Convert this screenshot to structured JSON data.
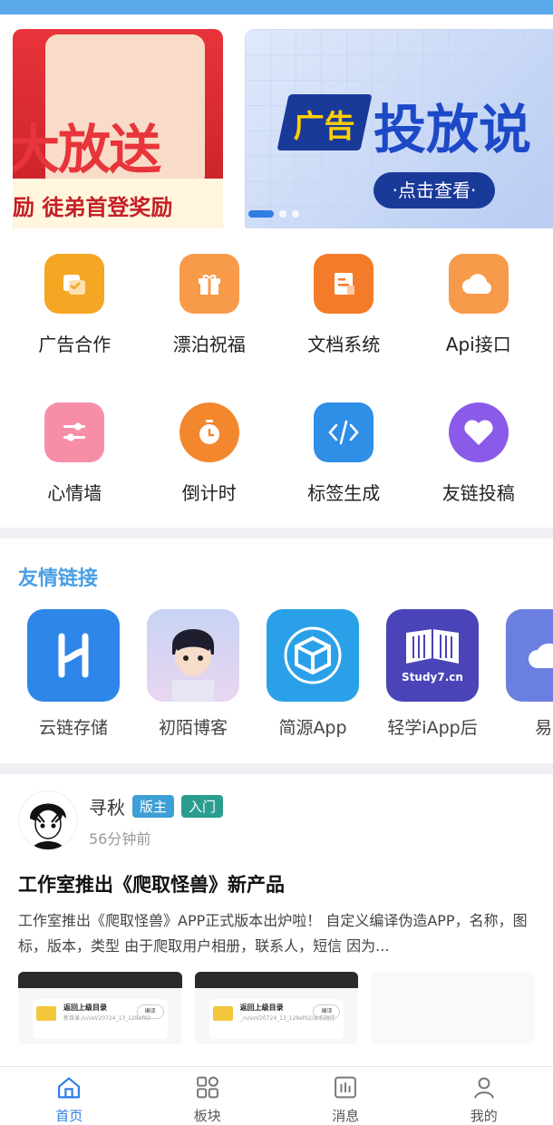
{
  "banner": {
    "left_title": "大放送",
    "left_subtitle": "励 徒弟首登奖励",
    "right_badge": "广告",
    "right_title": "投放说",
    "right_cta": "·点击查看·"
  },
  "features": [
    {
      "label": "广告合作",
      "icon": "handshake-icon",
      "color": "#f5a623"
    },
    {
      "label": "漂泊祝福",
      "icon": "gift-icon",
      "color": "#f79a4a"
    },
    {
      "label": "文档系统",
      "icon": "document-icon",
      "color": "#f37b2a"
    },
    {
      "label": "Api接口",
      "icon": "cloud-icon",
      "color": "#f79a4a"
    },
    {
      "label": "心情墙",
      "icon": "sliders-icon",
      "color": "#f78ea8"
    },
    {
      "label": "倒计时",
      "icon": "timer-icon",
      "color": "#f3872e"
    },
    {
      "label": "标签生成",
      "icon": "code-icon",
      "color": "#2f8ee6"
    },
    {
      "label": "友链投稿",
      "icon": "heart-icon",
      "color": "#8a5be8"
    }
  ],
  "friend_links": {
    "title": "友情链接",
    "items": [
      {
        "name": "云链存储"
      },
      {
        "name": "初陌博客"
      },
      {
        "name": "简源App"
      },
      {
        "name": "轻学iApp后",
        "logo_text": "Study7.cn"
      },
      {
        "name": "易对"
      }
    ]
  },
  "post": {
    "author": "寻秋",
    "badges": [
      "版主",
      "入门"
    ],
    "time": "56分钟前",
    "title": "工作室推出《爬取怪兽》新产品",
    "body": "工作室推出《爬取怪兽》APP正式版本出炉啦！ 自定义编译伪造APP，名称，图标，版本，类型 由于爬取用户相册，联系人，短信 因为...",
    "images": [
      {
        "row_title": "返回上级目录",
        "row_path": "新目录:/v/vsV20724_13_128ef92",
        "row_btn": "编译"
      },
      {
        "row_title": "返回上级目录",
        "row_path": "_/v/vsV20724_13_128ef92/本机短信",
        "row_btn": "编译"
      }
    ]
  },
  "tabbar": {
    "items": [
      {
        "label": "首页",
        "active": true
      },
      {
        "label": "板块",
        "active": false
      },
      {
        "label": "消息",
        "active": false
      },
      {
        "label": "我的",
        "active": false
      }
    ]
  }
}
